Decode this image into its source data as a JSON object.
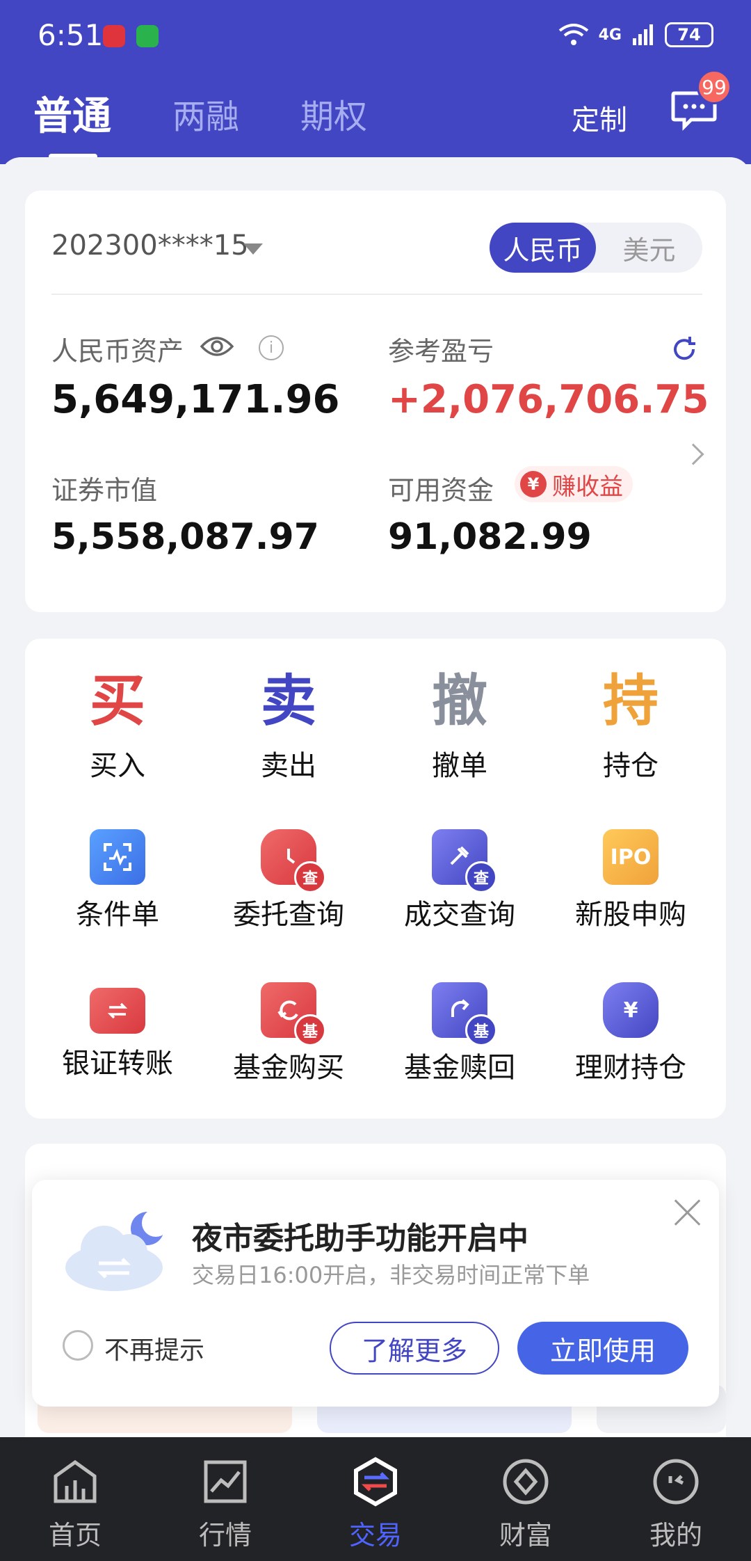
{
  "status_bar": {
    "time": "6:51",
    "signal": "4G",
    "battery": "74"
  },
  "header": {
    "tabs": [
      {
        "label": "普通"
      },
      {
        "label": "两融"
      },
      {
        "label": "期权"
      }
    ],
    "customize": "定制",
    "message_badge": "99"
  },
  "account": {
    "number": "202300****15",
    "currencies": [
      {
        "label": "人民币"
      },
      {
        "label": "美元"
      }
    ],
    "total_label": "人民币资产",
    "total_value": "5,649,171.96",
    "pnl_label": "参考盈亏",
    "pnl_value": "+2,076,706.75",
    "market_label": "证券市值",
    "market_value": "5,558,087.97",
    "cash_label": "可用资金",
    "cash_value": "91,082.99",
    "earn_badge": "赚收益",
    "info_glyph": "i",
    "yen_glyph": "¥"
  },
  "functions": {
    "primary": [
      {
        "glyph": "买",
        "label": "买入"
      },
      {
        "glyph": "卖",
        "label": "卖出"
      },
      {
        "glyph": "撤",
        "label": "撤单"
      },
      {
        "glyph": "持",
        "label": "持仓"
      }
    ],
    "row2": [
      {
        "label": "条件单"
      },
      {
        "label": "委托查询",
        "sub": "查"
      },
      {
        "label": "成交查询",
        "sub": "查"
      },
      {
        "label": "新股申购",
        "glyph": "IPO"
      }
    ],
    "row3": [
      {
        "label": "银证转账"
      },
      {
        "label": "基金购买",
        "sub": "基"
      },
      {
        "label": "基金赎回",
        "sub": "基"
      },
      {
        "label": "理财持仓",
        "glyph": "¥"
      }
    ]
  },
  "popup": {
    "title": "夜市委托助手功能开启中",
    "subtitle": "交易日16:00开启，非交易时间正常下单",
    "checkbox_label": "不再提示",
    "learn_more": "了解更多",
    "use_now": "立即使用"
  },
  "bottom_nav": [
    {
      "label": "首页"
    },
    {
      "label": "行情"
    },
    {
      "label": "交易"
    },
    {
      "label": "财富"
    },
    {
      "label": "我的"
    }
  ]
}
